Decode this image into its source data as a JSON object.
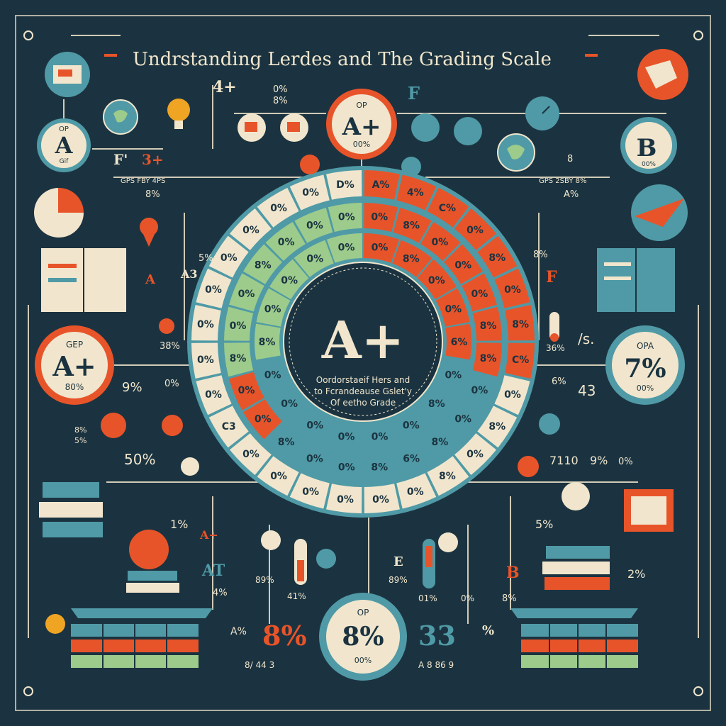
{
  "title": "Undrstanding Lerdes and The Grading Scale",
  "colors": {
    "background": "#1b3340",
    "cream": "#f1e6cd",
    "orange": "#e8542a",
    "teal": "#4f9aa6",
    "green": "#9ccb8c",
    "dark": "#1b3340"
  },
  "center": {
    "grade": "A+",
    "subtitle_line1": "Oordorstaeif Hers and",
    "subtitle_line2": "to Fcrandeause Gslet'y",
    "subtitle_line3": "Of eetho Grade"
  },
  "ring_cells": {
    "outer": [
      "A%",
      "4%",
      "C%",
      "0%",
      "8%",
      "0%",
      "8%",
      "C%",
      "0%",
      "8%",
      "0%",
      "8%",
      "0%",
      "0%",
      "0%",
      "0%",
      "0%",
      "0%",
      "C3",
      "0%",
      "0%",
      "0%",
      "0%",
      "0%",
      "0%",
      "0%",
      "0%",
      "D%"
    ],
    "middle": [
      "0%",
      "8%",
      "0%",
      "0%",
      "0%",
      "8%",
      "8%",
      "0%",
      "0%",
      "8%",
      "6%",
      "8%",
      "0%",
      "0%",
      "8%",
      "0%",
      "0%",
      "8%",
      "0%",
      "0%",
      "8%",
      "0%",
      "0%",
      "0%"
    ],
    "inner": [
      "0%",
      "8%",
      "0%",
      "0%",
      "6%",
      "0%",
      "8%",
      "0%",
      "0%",
      "0%",
      "0%",
      "0%",
      "0%",
      "8%",
      "0%",
      "0%",
      "0%",
      "0%"
    ]
  },
  "badges": {
    "top_center": {
      "top": "OP",
      "grade": "A+",
      "bottom": "00%"
    },
    "top_left": {
      "top": "OP",
      "grade": "A",
      "bottom": "Gif"
    },
    "top_right": {
      "top": "",
      "grade": "B",
      "bottom": "00%"
    },
    "mid_left": {
      "top": "GEP",
      "grade": "A+",
      "bottom": "80%"
    },
    "mid_right": {
      "top": "OPA",
      "grade": "7%",
      "bottom": "00%"
    },
    "bottom_center": {
      "top": "OP",
      "grade": "8%",
      "bottom": "00%"
    }
  },
  "labels": {
    "top_a_plus": "4+",
    "top_pct_1": "0%",
    "top_pct_2": "8%",
    "top_f": "F",
    "left_fp": "F'",
    "left_3plus": "3+",
    "left_gpa_row": "GPS FBY 4PS",
    "left_pct_row": "8%",
    "right_pct_row": "A%",
    "right_gpa_row": "GPS 2SBY 8%",
    "right_pct_small": "8",
    "left_5pct": "5%",
    "left_a": "A",
    "left_a3": "A3",
    "left_38": "38%",
    "left_9pct": "9%",
    "left_0pct": "0%",
    "left_50pct": "50%",
    "left_5pct_b": "5%",
    "left_8pct_b": "8%",
    "right_8pct": "8%",
    "right_f": "F",
    "right_36": "36%",
    "right_slash": "/s.",
    "right_6pct": "6%",
    "right_43": "43",
    "right_7110": "7110",
    "right_9pct": "9%",
    "right_0pct": "0%",
    "bottom_1pct": "1%",
    "bottom_a_plus": "A+",
    "bottom_at": "AT",
    "bottom_4pct": "4%",
    "bottom_89a": "89%",
    "bottom_41": "41%",
    "bottom_89b": "89%",
    "bottom_01": "01%",
    "bottom_0pct": "0%",
    "bottom_e": "E",
    "bottom_b": "B",
    "bottom_8pct_b": "8%",
    "bottom_5pct": "5%",
    "bottom_2pct": "2%",
    "bottom_ap": "A%",
    "bottom_big_8": "8%",
    "bottom_33": "33",
    "bottom_pct_icon": "%",
    "bottom_left_seq": "8/ 44 3",
    "bottom_right_seq": "A 8 86 9",
    "right_side_36": "36"
  }
}
